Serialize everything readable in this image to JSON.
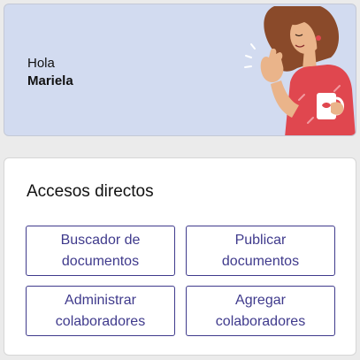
{
  "greeting": {
    "hello": "Hola",
    "name": "Mariela"
  },
  "shortcuts": {
    "title": "Accesos directos",
    "items": [
      {
        "label": "Buscador de\ndocumentos"
      },
      {
        "label": "Publicar\ndocumentos"
      },
      {
        "label": "Administrar\ncolaboradores"
      },
      {
        "label": "Agregar\ncolaboradores"
      }
    ]
  },
  "colors": {
    "hero_bg": "#d2dbf0",
    "button_accent": "#3f3a8c",
    "shirt": "#e0474f",
    "hair": "#8a4a2a",
    "skin": "#eab48a"
  }
}
